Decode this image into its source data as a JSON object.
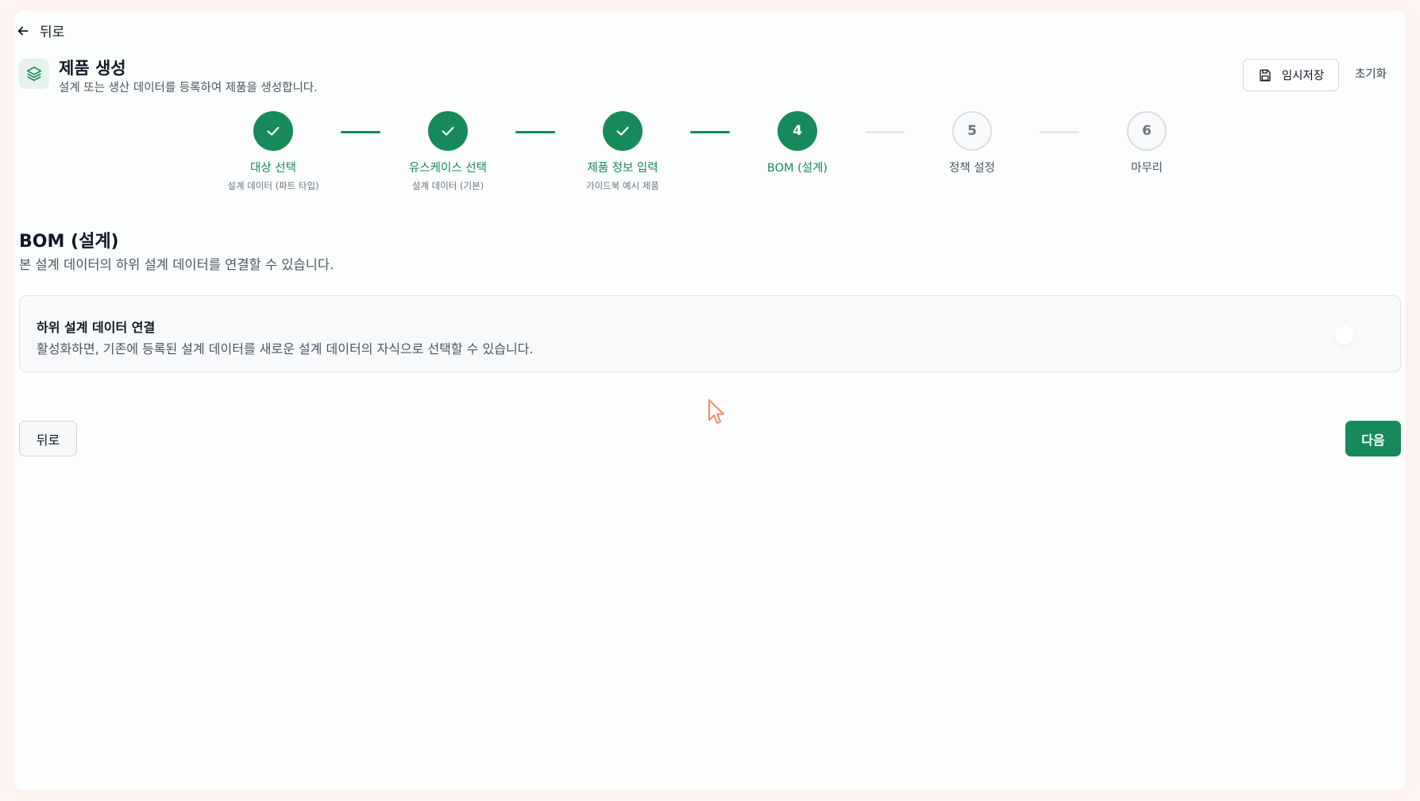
{
  "nav": {
    "back_label": "뒤로"
  },
  "header": {
    "title": "제품 생성",
    "subtitle": "설계 또는 생산 데이터를 등록하여 제품을 생성합니다.",
    "draft_label": "임시저장",
    "reset_label": "초기화"
  },
  "stepper": {
    "steps": [
      {
        "number": "1",
        "label": "대상 선택",
        "sublabel": "설계 데이터 (파트 타입)",
        "status": "done"
      },
      {
        "number": "2",
        "label": "유스케이스 선택",
        "sublabel": "설계 데이터 (기본)",
        "status": "done"
      },
      {
        "number": "3",
        "label": "제품 정보 입력",
        "sublabel": "가이드북 예시 제품",
        "status": "done"
      },
      {
        "number": "4",
        "label": "BOM (설계)",
        "sublabel": "",
        "status": "active"
      },
      {
        "number": "5",
        "label": "정책 설정",
        "sublabel": "",
        "status": "todo"
      },
      {
        "number": "6",
        "label": "마무리",
        "sublabel": "",
        "status": "todo"
      }
    ]
  },
  "section": {
    "title": "BOM (설계)",
    "description": "본 설계 데이터의 하위 설계 데이터를 연결할 수 있습니다."
  },
  "card": {
    "title": "하위 설계 데이터 연결",
    "description": "활성화하면, 기존에 등록된 설계 데이터를 새로운 설계 데이터의 자식으로 선택할 수 있습니다.",
    "toggle_on": false
  },
  "footer": {
    "back_label": "뒤로",
    "next_label": "다음"
  },
  "colors": {
    "accent": "#168a5a",
    "muted": "#6b7280",
    "cursor": "#f08a6a"
  }
}
